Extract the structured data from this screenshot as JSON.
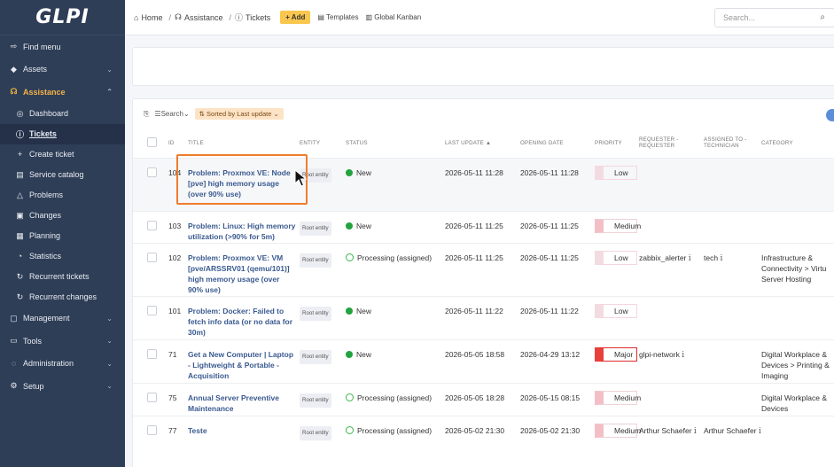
{
  "app": {
    "logo": "GLPI"
  },
  "sidebar": {
    "items": [
      {
        "label": "Find menu",
        "icon": "arrow-right-icon",
        "glyph": "⇨"
      },
      {
        "label": "Assets",
        "icon": "cube-icon",
        "glyph": "◆",
        "chevron": "⌄"
      },
      {
        "label": "Assistance",
        "icon": "headset-icon",
        "glyph": "☊",
        "chevron": "⌃"
      },
      {
        "label": "Dashboard",
        "icon": "dashboard-icon",
        "glyph": "◎"
      },
      {
        "label": "Tickets",
        "icon": "alert-circle-icon",
        "glyph": "ⓘ"
      },
      {
        "label": "Create ticket",
        "icon": "plus-icon",
        "glyph": "+"
      },
      {
        "label": "Service catalog",
        "icon": "catalog-icon",
        "glyph": "▤"
      },
      {
        "label": "Problems",
        "icon": "warning-triangle-icon",
        "glyph": "△"
      },
      {
        "label": "Changes",
        "icon": "clipboard-icon",
        "glyph": "▣"
      },
      {
        "label": "Planning",
        "icon": "calendar-icon",
        "glyph": "▦"
      },
      {
        "label": "Statistics",
        "icon": "chart-icon",
        "glyph": "◔"
      },
      {
        "label": "Recurrent tickets",
        "icon": "recurrent-icon",
        "glyph": "↻"
      },
      {
        "label": "Recurrent changes",
        "icon": "recurrent-changes-icon",
        "glyph": "↻"
      },
      {
        "label": "Management",
        "icon": "wallet-icon",
        "glyph": "▢",
        "chevron": "⌄"
      },
      {
        "label": "Tools",
        "icon": "briefcase-icon",
        "glyph": "▭",
        "chevron": "⌄"
      },
      {
        "label": "Administration",
        "icon": "admin-icon",
        "glyph": "◌",
        "chevron": "⌄"
      },
      {
        "label": "Setup",
        "icon": "gear-icon",
        "glyph": "⚙",
        "chevron": "⌄"
      }
    ]
  },
  "topbar": {
    "home": "Home",
    "assistance": "Assistance",
    "tickets": "Tickets",
    "add": "+ Add",
    "templates": "Templates",
    "kanban": "Global Kanban",
    "search_placeholder": "Search..."
  },
  "list": {
    "search_label": "Search",
    "sorted_label": "Sorted by Last update",
    "columns": [
      "ID",
      "TITLE",
      "ENTITY",
      "STATUS",
      "LAST UPDATE ▲",
      "OPENING DATE",
      "PRIORITY",
      "REQUESTER - REQUESTER",
      "ASSIGNED TO - TECHNICIAN",
      "CATEGORY"
    ],
    "rows": [
      {
        "id": "104",
        "title": "Problem: Proxmox VE: Node [pve] high memory usage (over 90% use)",
        "entity": "Root entity",
        "status": "New",
        "status_kind": "new",
        "last_update": "2026-05-11 11:28",
        "opening": "2026-05-11 11:28",
        "priority": "Low",
        "priority_kind": "low",
        "requester": "",
        "technician": "",
        "category": ""
      },
      {
        "id": "103",
        "title": "Problem: Linux: High memory utilization (>90% for 5m)",
        "entity": "Root entity",
        "status": "New",
        "status_kind": "new",
        "last_update": "2026-05-11 11:25",
        "opening": "2026-05-11 11:25",
        "priority": "Medium",
        "priority_kind": "medium",
        "requester": "",
        "technician": "",
        "category": ""
      },
      {
        "id": "102",
        "title": "Problem: Proxmox VE: VM [pve/ARSSRV01 (qemu/101)] high memory usage (over 90% use)",
        "entity": "Root entity",
        "status": "Processing (assigned)",
        "status_kind": "processing",
        "last_update": "2026-05-11 11:25",
        "opening": "2026-05-11 11:25",
        "priority": "Low",
        "priority_kind": "low",
        "requester": "zabbix_alerter",
        "requester_info": "i",
        "technician": "tech",
        "technician_info": "i",
        "category": "Infrastructure & Connectivity > Virtu Server Hosting"
      },
      {
        "id": "101",
        "title": "Problem: Docker: Failed to fetch info data (or no data for 30m)",
        "entity": "Root entity",
        "status": "New",
        "status_kind": "new",
        "last_update": "2026-05-11 11:22",
        "opening": "2026-05-11 11:22",
        "priority": "Low",
        "priority_kind": "low",
        "requester": "",
        "technician": "",
        "category": ""
      },
      {
        "id": "71",
        "title": "Get a New Computer | Laptop - Lightweight & Portable - Acquisition",
        "entity": "Root entity",
        "status": "New",
        "status_kind": "new",
        "last_update": "2026-05-05 18:58",
        "opening": "2026-04-29 13:12",
        "priority": "Major",
        "priority_kind": "major",
        "requester": "glpi-network",
        "requester_info": "i",
        "technician": "",
        "category": "Digital Workplace & Devices > Printing & Imaging"
      },
      {
        "id": "75",
        "title": "Annual Server Preventive Maintenance",
        "entity": "Root entity",
        "status": "Processing (assigned)",
        "status_kind": "processing",
        "last_update": "2026-05-05 18:28",
        "opening": "2026-05-15 08:15",
        "priority": "Medium",
        "priority_kind": "medium",
        "requester": "",
        "technician": "",
        "category": "Digital Workplace & Devices"
      },
      {
        "id": "77",
        "title": "Teste",
        "entity": "Root entity",
        "status": "Processing (assigned)",
        "status_kind": "processing",
        "last_update": "2026-05-02 21:30",
        "opening": "2026-05-02 21:30",
        "priority": "Medium",
        "priority_kind": "medium",
        "requester": "Arthur Schaefer",
        "requester_info": "i",
        "technician": "Arthur Schaefer",
        "technician_info": "i",
        "category": ""
      }
    ]
  },
  "colors": {
    "sidebar": "#2f3e57",
    "accent": "#f3b245",
    "link": "#3a5a90",
    "highlight": "#ef7c2f"
  }
}
